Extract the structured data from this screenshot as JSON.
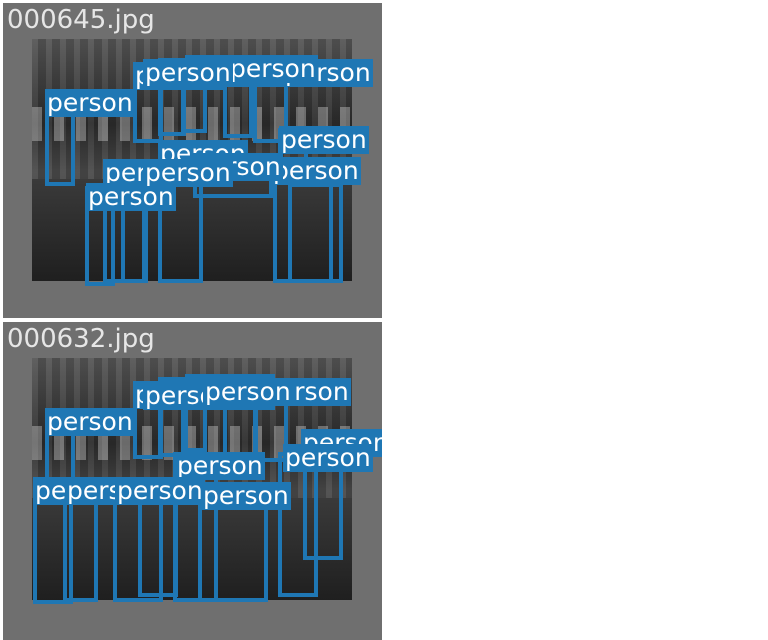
{
  "label_text": "person",
  "box_color": "#1f77b4",
  "panels": [
    {
      "filename": "000645.jpg",
      "person_count": 14
    },
    {
      "filename": "000632.jpg",
      "person_count": 14
    }
  ]
}
